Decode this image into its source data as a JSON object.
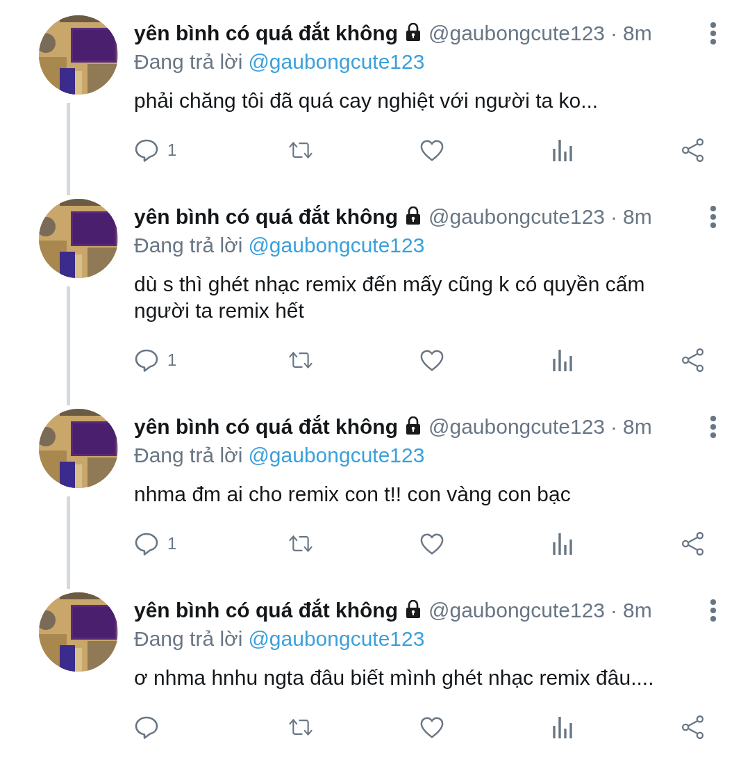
{
  "tweets": [
    {
      "name": "yên bình có quá đắt không",
      "locked": true,
      "handle": "@gaubongcute123",
      "time": "8m",
      "replying_label": "Đang trả lời",
      "replying_to": "@gaubongcute123",
      "text": "phải chăng tôi đã quá cay nghiệt với người ta ko...",
      "reply_count": "1",
      "thread_line": true,
      "separator": "·"
    },
    {
      "name": "yên bình có quá đắt không",
      "locked": true,
      "handle": "@gaubongcute123",
      "time": "8m",
      "replying_label": "Đang trả lời",
      "replying_to": "@gaubongcute123",
      "text": "dù s thì ghét nhạc remix đến mấy cũng k có quyền cấm người ta remix hết",
      "reply_count": "1",
      "thread_line": true,
      "separator": "·"
    },
    {
      "name": "yên bình có quá đắt không",
      "locked": true,
      "handle": "@gaubongcute123",
      "time": "8m",
      "replying_label": "Đang trả lời",
      "replying_to": "@gaubongcute123",
      "text": "nhma đm ai cho remix con t!! con vàng con bạc",
      "reply_count": "1",
      "thread_line": true,
      "separator": "·"
    },
    {
      "name": "yên bình có quá đắt không",
      "locked": true,
      "handle": "@gaubongcute123",
      "time": "8m",
      "replying_label": "Đang trả lời",
      "replying_to": "@gaubongcute123",
      "text": "ơ nhma hnhu ngta đâu biết mình ghét nhạc remix đâu....",
      "thread_line": false,
      "separator": "·"
    }
  ]
}
